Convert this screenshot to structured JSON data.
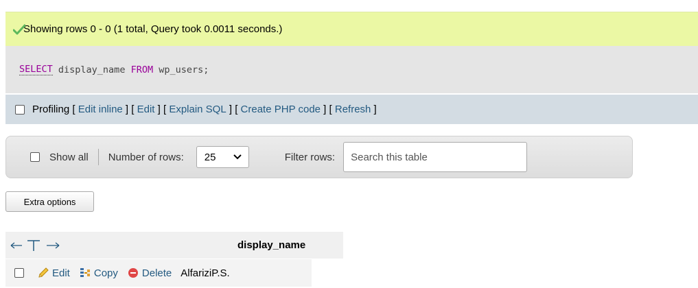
{
  "message": {
    "text": "Showing rows 0 - 0 (1 total, Query took 0.0011 seconds.)",
    "icon": "check-icon"
  },
  "sql": {
    "select_kw": "SELECT",
    "column": " display_name ",
    "from_kw": "FROM",
    "rest": " wp_users;"
  },
  "profiling": {
    "label": "Profiling",
    "links": [
      "Edit inline",
      "Edit",
      "Explain SQL",
      "Create PHP code",
      "Refresh"
    ]
  },
  "navigation": {
    "show_all": "Show all",
    "rows_label": "Number of rows:",
    "rows_value": "25",
    "filter_label": "Filter rows:",
    "search_placeholder": "Search this table"
  },
  "extra_options": "Extra options",
  "table": {
    "column_header": "display_name",
    "rows": [
      {
        "edit": "Edit",
        "copy": "Copy",
        "delete": "Delete",
        "display_name": "AlfariziP.S."
      }
    ]
  },
  "colors": {
    "success_bg": "#ebf8a4",
    "link": "#235a81",
    "keyword": "#990099"
  }
}
